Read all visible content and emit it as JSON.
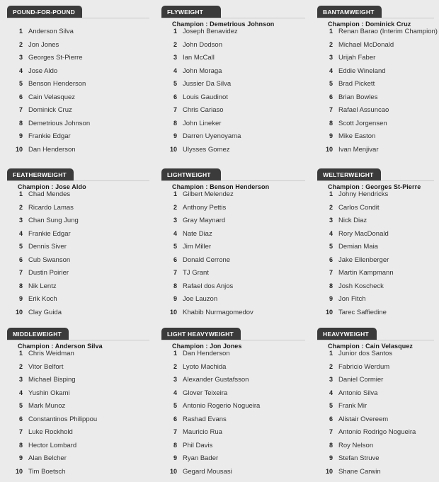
{
  "theme": {
    "background": "#ebebeb",
    "tab_background": "#3b3b3b",
    "tab_text": "#ffffff",
    "rule_color": "#c9c9c9",
    "text_color": "#333333"
  },
  "divisions": [
    {
      "title": "POUND-FOR-POUND",
      "champion": "",
      "fighters": [
        {
          "rank": "1",
          "name": "Anderson Silva"
        },
        {
          "rank": "2",
          "name": "Jon Jones"
        },
        {
          "rank": "3",
          "name": "Georges St-Pierre"
        },
        {
          "rank": "4",
          "name": "Jose Aldo"
        },
        {
          "rank": "5",
          "name": "Benson Henderson"
        },
        {
          "rank": "6",
          "name": "Cain Velasquez"
        },
        {
          "rank": "7",
          "name": "Dominick Cruz"
        },
        {
          "rank": "8",
          "name": "Demetrious Johnson"
        },
        {
          "rank": "9",
          "name": "Frankie Edgar"
        },
        {
          "rank": "10",
          "name": "Dan Henderson"
        }
      ]
    },
    {
      "title": "FLYWEIGHT",
      "champion": "Champion : Demetrious Johnson",
      "fighters": [
        {
          "rank": "1",
          "name": "Joseph Benavidez"
        },
        {
          "rank": "2",
          "name": "John Dodson"
        },
        {
          "rank": "3",
          "name": "Ian McCall"
        },
        {
          "rank": "4",
          "name": "John Moraga"
        },
        {
          "rank": "5",
          "name": "Jussier Da Silva"
        },
        {
          "rank": "6",
          "name": "Louis Gaudinot"
        },
        {
          "rank": "7",
          "name": "Chris Cariaso"
        },
        {
          "rank": "8",
          "name": "John Lineker"
        },
        {
          "rank": "9",
          "name": "Darren Uyenoyama"
        },
        {
          "rank": "10",
          "name": "Ulysses Gomez"
        }
      ]
    },
    {
      "title": "BANTAMWEIGHT",
      "champion": "Champion : Dominick Cruz",
      "fighters": [
        {
          "rank": "1",
          "name": "Renan Barao (Interim Champion)"
        },
        {
          "rank": "2",
          "name": "Michael McDonald"
        },
        {
          "rank": "3",
          "name": "Urijah Faber"
        },
        {
          "rank": "4",
          "name": "Eddie Wineland"
        },
        {
          "rank": "5",
          "name": "Brad Pickett"
        },
        {
          "rank": "6",
          "name": "Brian Bowles"
        },
        {
          "rank": "7",
          "name": "Rafael Assuncao"
        },
        {
          "rank": "8",
          "name": "Scott Jorgensen"
        },
        {
          "rank": "9",
          "name": "Mike Easton"
        },
        {
          "rank": "10",
          "name": "Ivan Menjivar"
        }
      ]
    },
    {
      "title": "FEATHERWEIGHT",
      "champion": "Champion : Jose Aldo",
      "fighters": [
        {
          "rank": "1",
          "name": "Chad Mendes"
        },
        {
          "rank": "2",
          "name": "Ricardo Lamas"
        },
        {
          "rank": "3",
          "name": "Chan Sung Jung"
        },
        {
          "rank": "4",
          "name": "Frankie Edgar"
        },
        {
          "rank": "5",
          "name": "Dennis Siver"
        },
        {
          "rank": "6",
          "name": "Cub Swanson"
        },
        {
          "rank": "7",
          "name": "Dustin Poirier"
        },
        {
          "rank": "8",
          "name": "Nik Lentz"
        },
        {
          "rank": "9",
          "name": "Erik Koch"
        },
        {
          "rank": "10",
          "name": "Clay Guida"
        }
      ]
    },
    {
      "title": "LIGHTWEIGHT",
      "champion": "Champion : Benson Henderson",
      "fighters": [
        {
          "rank": "1",
          "name": "Gilbert Melendez"
        },
        {
          "rank": "2",
          "name": "Anthony Pettis"
        },
        {
          "rank": "3",
          "name": "Gray Maynard"
        },
        {
          "rank": "4",
          "name": "Nate Diaz"
        },
        {
          "rank": "5",
          "name": "Jim Miller"
        },
        {
          "rank": "6",
          "name": "Donald Cerrone"
        },
        {
          "rank": "7",
          "name": "TJ Grant"
        },
        {
          "rank": "8",
          "name": "Rafael dos Anjos"
        },
        {
          "rank": "9",
          "name": "Joe Lauzon"
        },
        {
          "rank": "10",
          "name": "Khabib Nurmagomedov"
        }
      ]
    },
    {
      "title": "WELTERWEIGHT",
      "champion": "Champion : Georges St-Pierre",
      "fighters": [
        {
          "rank": "1",
          "name": "Johny Hendricks"
        },
        {
          "rank": "2",
          "name": "Carlos Condit"
        },
        {
          "rank": "3",
          "name": "Nick Diaz"
        },
        {
          "rank": "4",
          "name": "Rory MacDonald"
        },
        {
          "rank": "5",
          "name": "Demian Maia"
        },
        {
          "rank": "6",
          "name": "Jake Ellenberger"
        },
        {
          "rank": "7",
          "name": "Martin Kampmann"
        },
        {
          "rank": "8",
          "name": "Josh Koscheck"
        },
        {
          "rank": "9",
          "name": "Jon Fitch"
        },
        {
          "rank": "10",
          "name": "Tarec Saffiedine"
        }
      ]
    },
    {
      "title": "MIDDLEWEIGHT",
      "champion": "Champion : Anderson Silva",
      "fighters": [
        {
          "rank": "1",
          "name": "Chris Weidman"
        },
        {
          "rank": "2",
          "name": "Vitor Belfort"
        },
        {
          "rank": "3",
          "name": "Michael Bisping"
        },
        {
          "rank": "4",
          "name": "Yushin Okami"
        },
        {
          "rank": "5",
          "name": "Mark Munoz"
        },
        {
          "rank": "6",
          "name": "Constantinos Philippou"
        },
        {
          "rank": "7",
          "name": "Luke Rockhold"
        },
        {
          "rank": "8",
          "name": "Hector Lombard"
        },
        {
          "rank": "9",
          "name": "Alan Belcher"
        },
        {
          "rank": "10",
          "name": "Tim Boetsch"
        }
      ]
    },
    {
      "title": "LIGHT HEAVYWEIGHT",
      "champion": "Champion : Jon Jones",
      "fighters": [
        {
          "rank": "1",
          "name": "Dan Henderson"
        },
        {
          "rank": "2",
          "name": "Lyoto Machida"
        },
        {
          "rank": "3",
          "name": "Alexander Gustafsson"
        },
        {
          "rank": "4",
          "name": "Glover Teixeira"
        },
        {
          "rank": "5",
          "name": "Antonio Rogerio Nogueira"
        },
        {
          "rank": "6",
          "name": "Rashad Evans"
        },
        {
          "rank": "7",
          "name": "Mauricio Rua"
        },
        {
          "rank": "8",
          "name": "Phil Davis"
        },
        {
          "rank": "9",
          "name": "Ryan Bader"
        },
        {
          "rank": "10",
          "name": "Gegard Mousasi"
        }
      ]
    },
    {
      "title": "HEAVYWEIGHT",
      "champion": "Champion : Cain Velasquez",
      "fighters": [
        {
          "rank": "1",
          "name": "Junior dos Santos"
        },
        {
          "rank": "2",
          "name": "Fabricio Werdum"
        },
        {
          "rank": "3",
          "name": "Daniel Cormier"
        },
        {
          "rank": "4",
          "name": "Antonio Silva"
        },
        {
          "rank": "5",
          "name": "Frank Mir"
        },
        {
          "rank": "6",
          "name": "Alistair Overeem"
        },
        {
          "rank": "7",
          "name": "Antonio Rodrigo Nogueira"
        },
        {
          "rank": "8",
          "name": "Roy Nelson"
        },
        {
          "rank": "9",
          "name": "Stefan Struve"
        },
        {
          "rank": "10",
          "name": "Shane Carwin"
        }
      ]
    }
  ]
}
